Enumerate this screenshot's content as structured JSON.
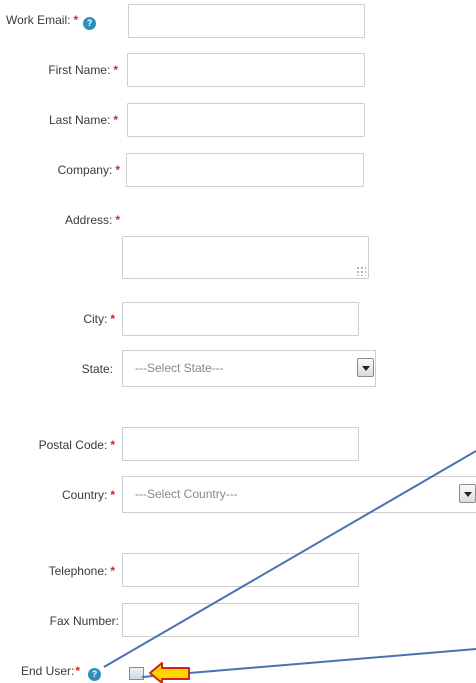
{
  "form": {
    "work_email": {
      "label": "Work Email:",
      "required": "*",
      "help": "?",
      "value": ""
    },
    "first_name": {
      "label": "First Name:",
      "required": "*",
      "value": ""
    },
    "last_name": {
      "label": "Last Name:",
      "required": "*",
      "value": ""
    },
    "company": {
      "label": "Company:",
      "required": "*",
      "value": ""
    },
    "address": {
      "label": "Address:",
      "required": "*",
      "value": ""
    },
    "city": {
      "label": "City:",
      "required": "*",
      "value": ""
    },
    "state": {
      "label": "State:",
      "selected": "---Select State---"
    },
    "postal_code": {
      "label": "Postal Code:",
      "required": "*",
      "value": ""
    },
    "country": {
      "label": "Country:",
      "required": "*",
      "selected": "---Select Country---"
    },
    "telephone": {
      "label": "Telephone:",
      "required": "*",
      "value": ""
    },
    "fax_number": {
      "label": "Fax Number:",
      "value": ""
    },
    "end_user": {
      "label": "End User:",
      "required": "*",
      "help": "?",
      "checked": false
    }
  },
  "annotation": {
    "line_color": "#4a72b0",
    "arrow_fill": "#ffd600",
    "arrow_stroke": "#d61f1f",
    "help_color": "#2b90bf",
    "required_color": "#d0282e"
  }
}
